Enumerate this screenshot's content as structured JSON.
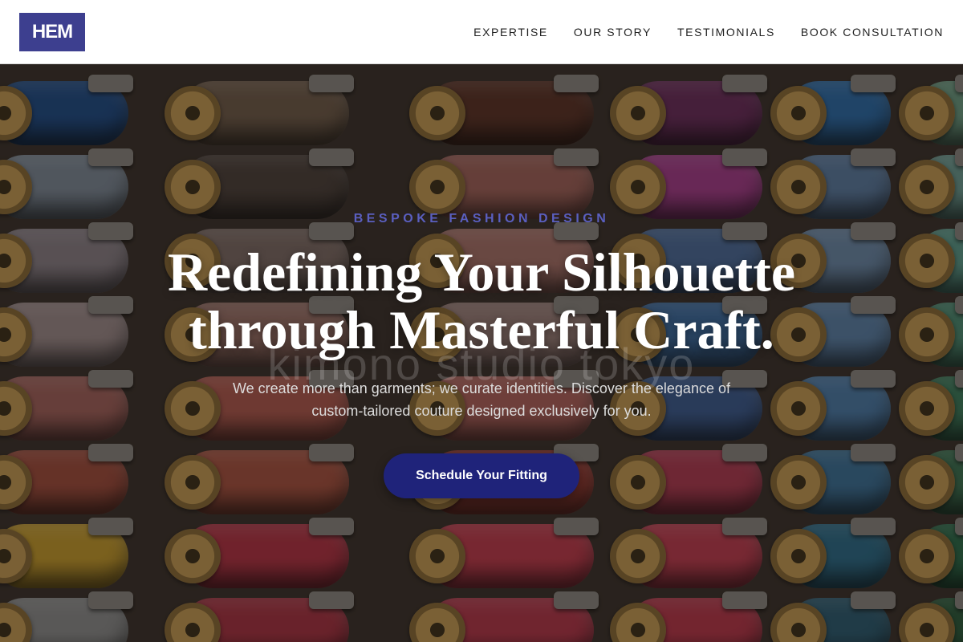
{
  "brand": {
    "logo_text": "HEM",
    "logo_color": "#3d3f8f"
  },
  "nav": {
    "items": [
      {
        "label": "EXPERTISE"
      },
      {
        "label": "OUR STORY"
      },
      {
        "label": "TESTIMONIALS"
      },
      {
        "label": "BOOK CONSULTATION"
      }
    ]
  },
  "hero": {
    "eyebrow": "BESPOKE FASHION DESIGN",
    "headline_line1": "Redefining Your Silhouette",
    "headline_line2": "through Masterful Craft.",
    "watermark": "kimono studio tokyo",
    "subtitle": "We create more than garments; we curate identities. Discover the elegance of custom-tailored couture designed exclusively for you.",
    "cta_label": "Schedule Your Fitting",
    "cta_color": "#1f237a",
    "eyebrow_color": "#5a5fc0",
    "background_image": "thread-spools-photo"
  }
}
